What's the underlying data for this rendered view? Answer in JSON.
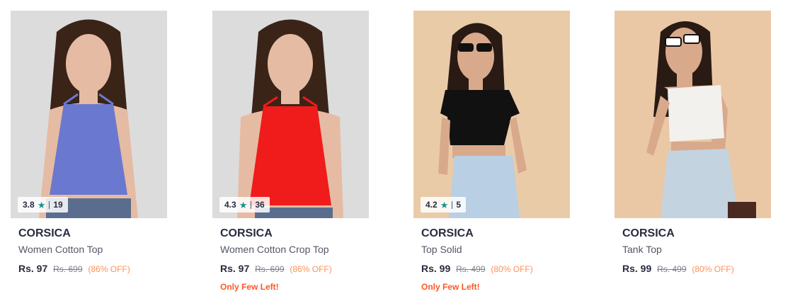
{
  "products": [
    {
      "rating": "3.8",
      "rating_count": "19",
      "brand": "CORSICA",
      "name": "Women Cotton Top",
      "price": "Rs. 97",
      "mrp": "Rs. 699",
      "discount": "(86% OFF)",
      "stock_note": "",
      "colors": {
        "bg": "#dcdcdc",
        "top": "#6a78cf",
        "skin": "#e6bba3",
        "hair": "#3a2418",
        "bottom": "#5a6d8f"
      },
      "image_style": "halter-top"
    },
    {
      "rating": "4.3",
      "rating_count": "36",
      "brand": "CORSICA",
      "name": "Women Cotton Crop Top",
      "price": "Rs. 97",
      "mrp": "Rs. 699",
      "discount": "(86% OFF)",
      "stock_note": "Only Few Left!",
      "colors": {
        "bg": "#dcdcdc",
        "top": "#f01b1b",
        "skin": "#e6bba3",
        "hair": "#3a2418",
        "bottom": "#5a6d8f"
      },
      "image_style": "halter-crop"
    },
    {
      "rating": "4.2",
      "rating_count": "5",
      "brand": "CORSICA",
      "name": "Top Solid",
      "price": "Rs. 99",
      "mrp": "Rs. 499",
      "discount": "(80% OFF)",
      "stock_note": "Only Few Left!",
      "colors": {
        "bg": "#e9cba8",
        "top": "#111111",
        "skin": "#d9a98c",
        "hair": "#2a1a14",
        "bottom": "#b9cfe3"
      },
      "image_style": "tee-crop-sunglasses"
    },
    {
      "rating": "",
      "rating_count": "",
      "brand": "CORSICA",
      "name": "Tank Top",
      "price": "Rs. 99",
      "mrp": "Rs. 499",
      "discount": "(80% OFF)",
      "stock_note": "",
      "colors": {
        "bg": "#eac8a6",
        "top": "#f3f1ed",
        "skin": "#d9a98c",
        "hair": "#2a1a14",
        "bottom": "#c3d3e0"
      },
      "image_style": "tank-white-sunglasses"
    }
  ],
  "icons": {
    "rating_star": "star-icon"
  }
}
